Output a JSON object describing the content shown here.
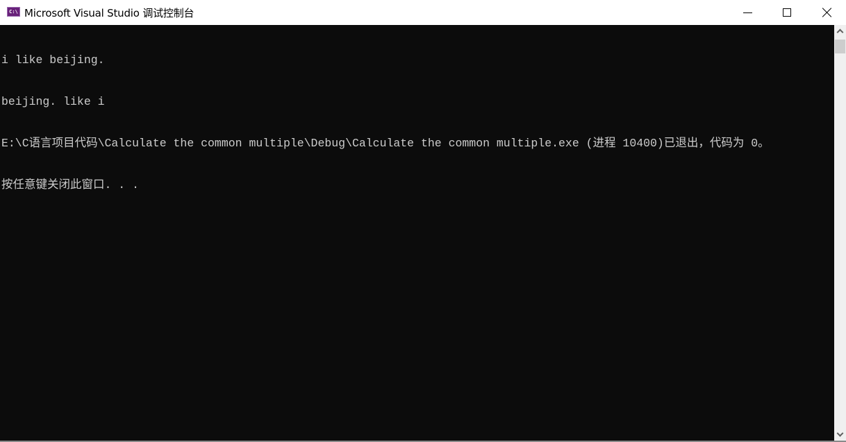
{
  "window": {
    "icon": "vs-console-icon",
    "icon_label": "C:\\",
    "title": "Microsoft Visual Studio 调试控制台",
    "controls": {
      "minimize": "minimize-icon",
      "maximize": "maximize-icon",
      "close": "close-icon"
    }
  },
  "console": {
    "background": "#0c0c0c",
    "foreground": "#cccccc",
    "lines": [
      "i like beijing.",
      "beijing. like i",
      "E:\\C语言项目代码\\Calculate the common multiple\\Debug\\Calculate the common multiple.exe (进程 10400)已退出，代码为 0。",
      "按任意键关闭此窗口. . ."
    ]
  },
  "scrollbar": {
    "up": "chevron-up-icon",
    "down": "chevron-down-icon"
  }
}
